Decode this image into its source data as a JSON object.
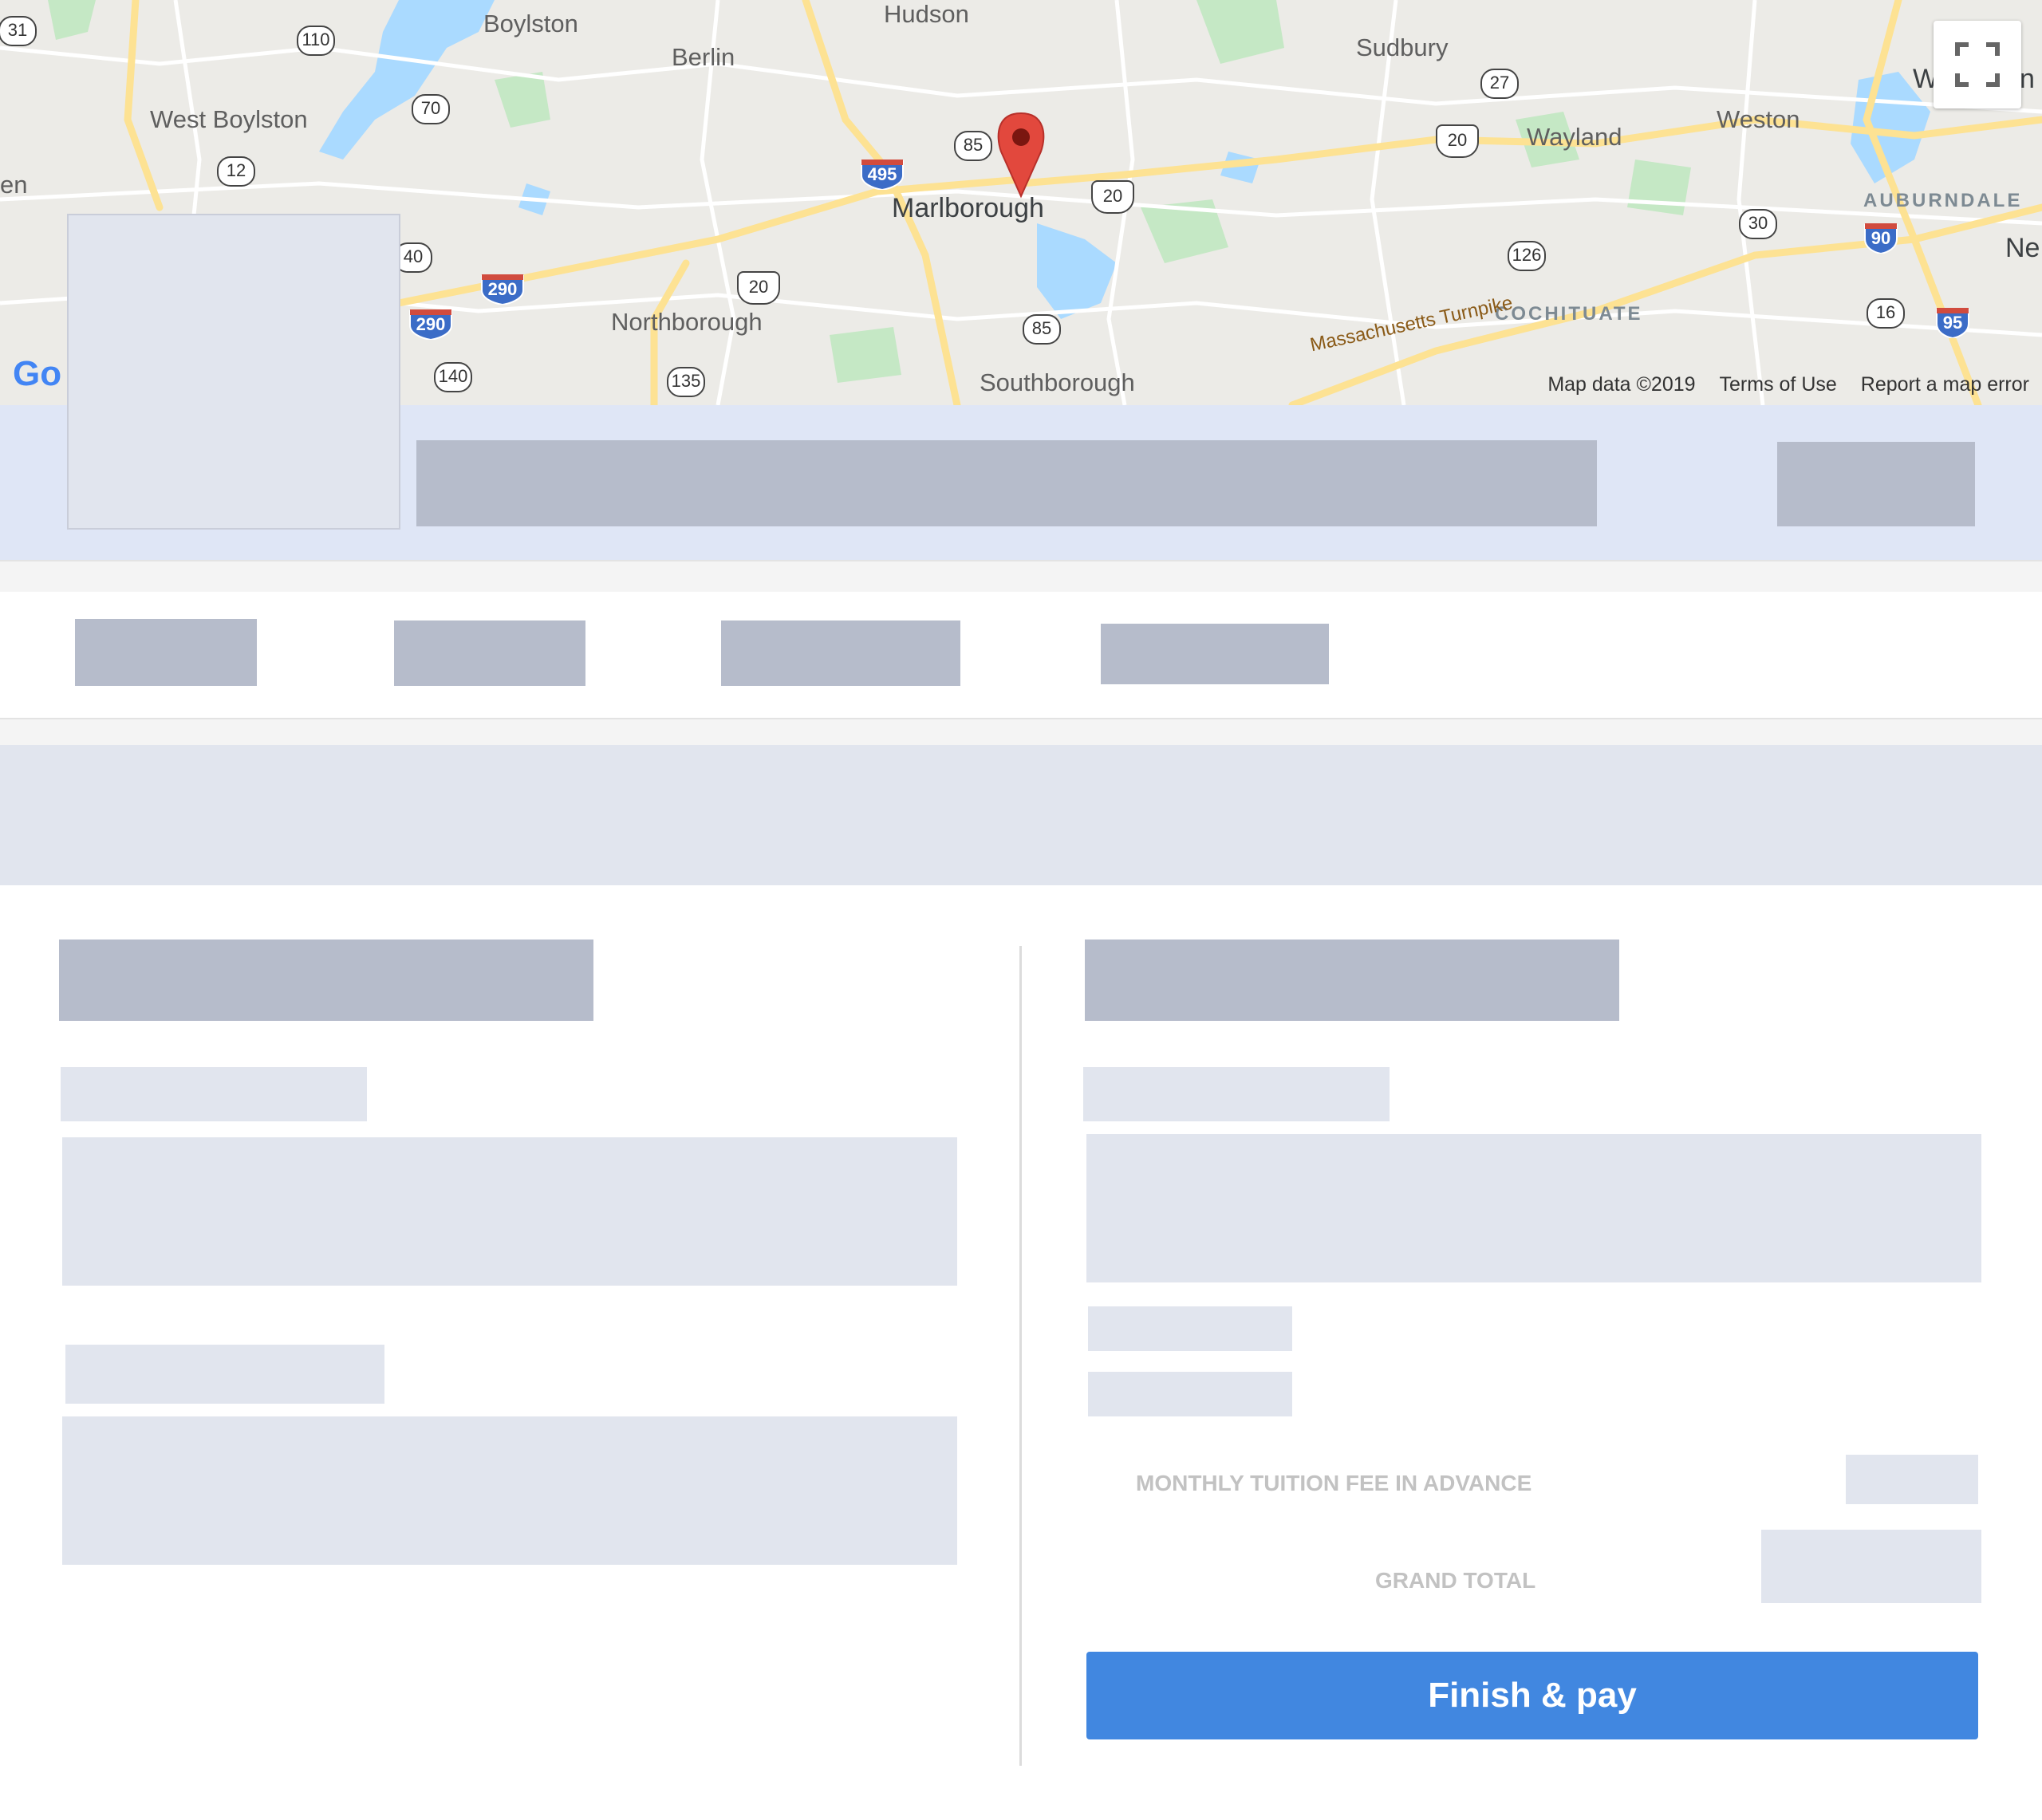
{
  "map": {
    "places": [
      {
        "name": "Hudson",
        "class": "place"
      },
      {
        "name": "Boylston",
        "class": "place"
      },
      {
        "name": "Berlin",
        "class": "place"
      },
      {
        "name": "Sudbury",
        "class": "place"
      },
      {
        "name": "West Boylston",
        "class": "place"
      },
      {
        "name": "Wayland",
        "class": "place"
      },
      {
        "name": "Weston",
        "class": "place"
      },
      {
        "name": "Marlborough",
        "class": "place big"
      },
      {
        "name": "Northborough",
        "class": "place"
      },
      {
        "name": "Southborough",
        "class": "place"
      },
      {
        "name": "AUBURNDALE",
        "class": "place district"
      },
      {
        "name": "COCHITUATE",
        "class": "place district"
      },
      {
        "name": "en",
        "class": "place"
      },
      {
        "name": "Ne",
        "class": "place"
      },
      {
        "name": "W",
        "class": "place"
      },
      {
        "name": "n",
        "class": "place"
      }
    ],
    "state_routes": [
      "31",
      "110",
      "70",
      "12",
      "40",
      "140",
      "135",
      "85",
      "85",
      "27",
      "126",
      "30",
      "16"
    ],
    "us_routes": [
      "20",
      "20",
      "20"
    ],
    "interstates": [
      "495",
      "290",
      "290",
      "90",
      "95"
    ],
    "turnpike_label": "Massachusetts Turnpike",
    "attribution": {
      "map_data": "Map data ©2019",
      "terms": "Terms of Use",
      "report": "Report a map error"
    },
    "logo_text": "Go",
    "colors": {
      "land": "#ecebe7",
      "water": "#aadaff",
      "park": "#c5e8c5",
      "highway": "#fde293",
      "marker": "#e2483d"
    }
  },
  "summary": {
    "monthly_label": "MONTHLY TUITION FEE IN ADVANCE",
    "grand_total_label": "GRAND TOTAL",
    "finish_label": "Finish & pay"
  },
  "colors": {
    "placeholder_dark": "#b6bccb",
    "placeholder_light": "#e1e5ee",
    "profile_band": "#dfe6f6",
    "primary_button": "#4187e0"
  }
}
